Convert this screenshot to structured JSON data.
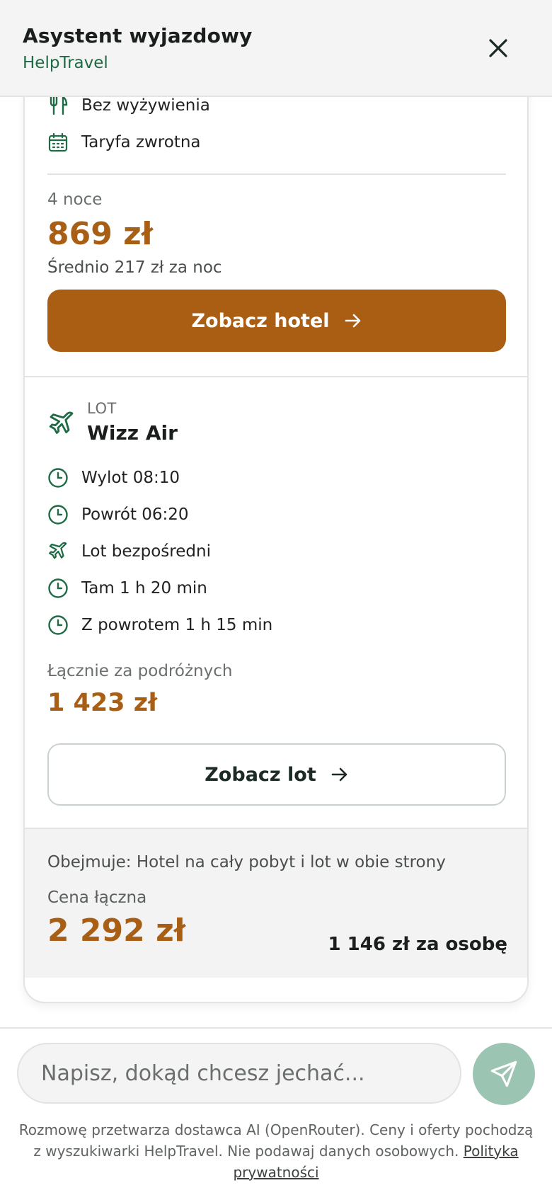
{
  "header": {
    "title": "Asystent wyjazdowy",
    "subtitle": "HelpTravel",
    "close_icon": "close-icon"
  },
  "hotel": {
    "features": [
      {
        "icon": "fork-knife-icon",
        "label": "Bez wyżywienia"
      },
      {
        "icon": "calendar-icon",
        "label": "Taryfa zwrotna"
      }
    ],
    "nights_label": "4 noce",
    "price": "869 zł",
    "avg_label": "Średnio 217 zł za noc",
    "button_label": "Zobacz hotel"
  },
  "flight": {
    "kicker": "LOT",
    "airline": "Wizz Air",
    "details": [
      {
        "icon": "clock-icon",
        "label": "Wylot 08:10"
      },
      {
        "icon": "clock-icon",
        "label": "Powrót 06:20"
      },
      {
        "icon": "plane-icon",
        "label": "Lot bezpośredni"
      },
      {
        "icon": "clock-icon",
        "label": "Tam 1 h 20 min"
      },
      {
        "icon": "clock-icon",
        "label": "Z powrotem 1 h 15 min"
      }
    ],
    "total_label": "Łącznie za podróżnych",
    "total_price": "1 423 zł",
    "button_label": "Zobacz lot"
  },
  "summary": {
    "includes": "Obejmuje: Hotel na cały pobyt i lot w obie strony",
    "total_label": "Cena łączna",
    "total_price": "2 292 zł",
    "per_person": "1 146 zł za osobę"
  },
  "composer": {
    "placeholder": "Napisz, dokąd chcesz jechać...",
    "disclaimer": "Rozmowę przetwarza dostawca AI (OpenRouter). Ceny i oferty pochodzą z wyszukiwarki HelpTravel. Nie podawaj danych osobowych.",
    "privacy_link": "Polityka prywatności"
  },
  "colors": {
    "brand_green": "#1f6b45",
    "accent_orange": "#aa5e14",
    "send_button": "#9cc4b3"
  }
}
